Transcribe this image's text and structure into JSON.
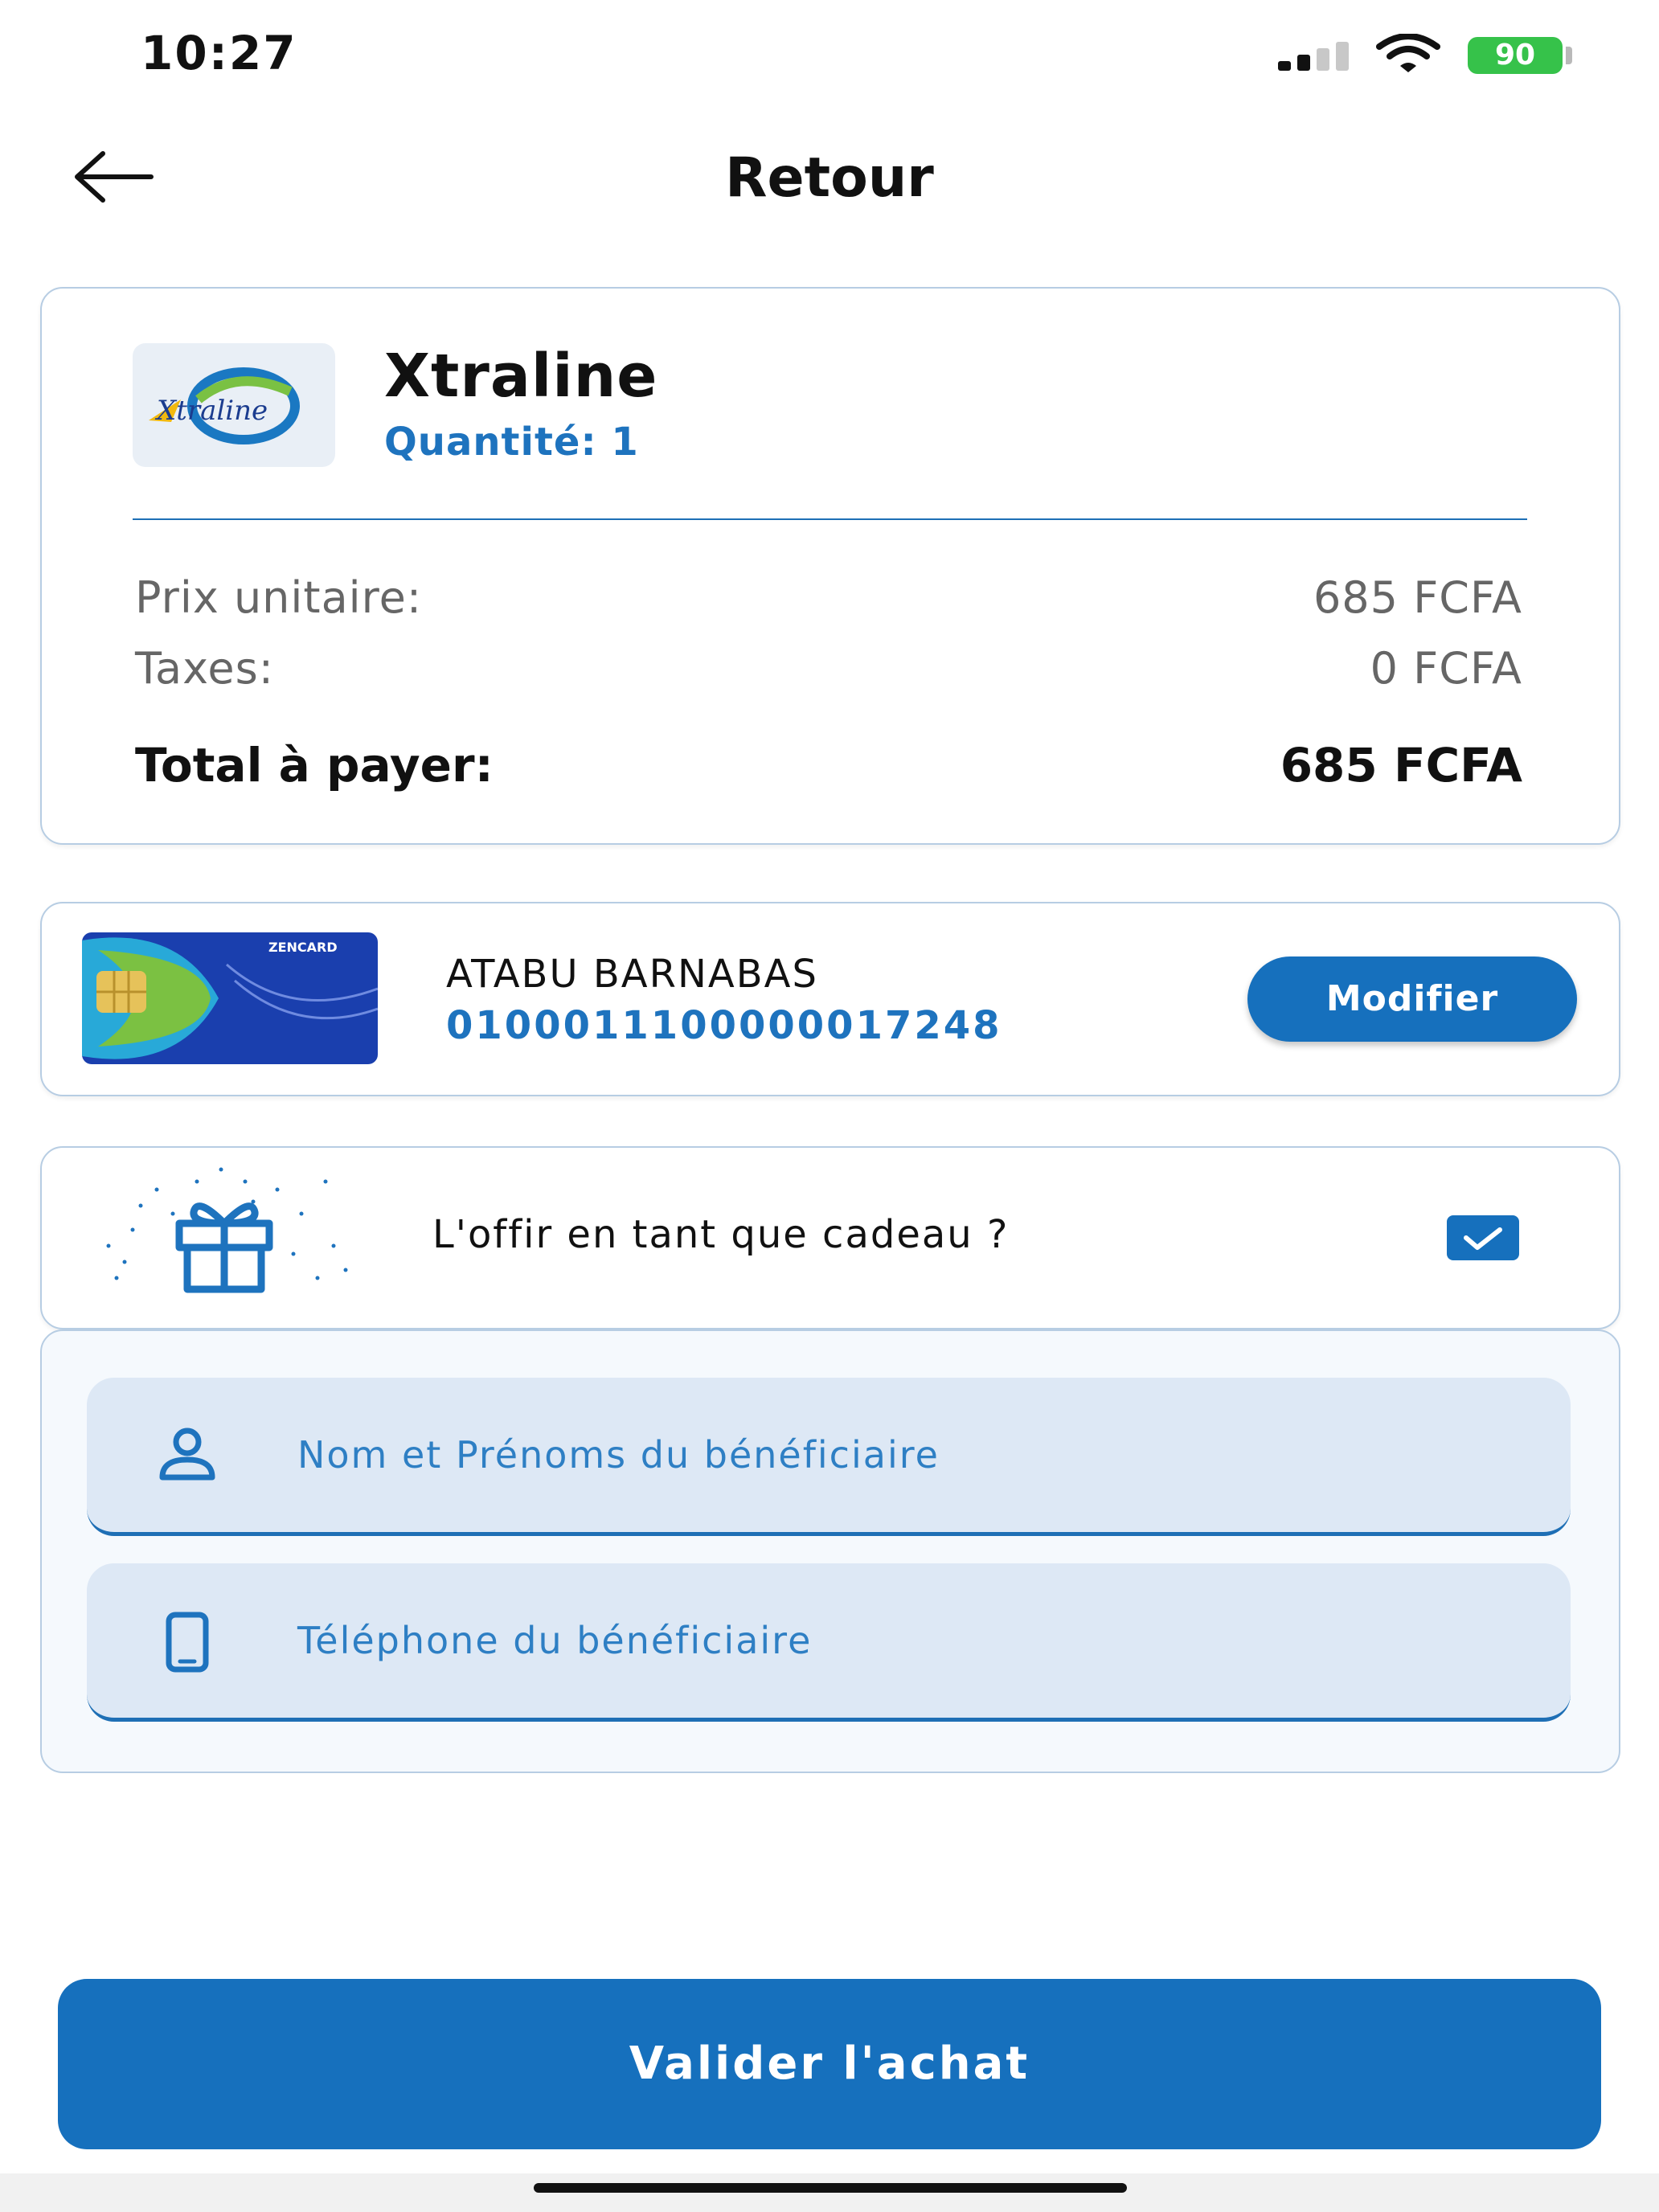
{
  "status_bar": {
    "time": "10:27",
    "battery": "90",
    "battery_color": "#36c24a"
  },
  "header": {
    "title": "Retour",
    "back_icon": "arrow-left-icon"
  },
  "product": {
    "logo_text": "Xtraline",
    "name": "Xtraline",
    "quantity_label": "Quantité:",
    "quantity_value": "1",
    "unit_price_label": "Prix unitaire:",
    "unit_price_value": "685 FCFA",
    "taxes_label": "Taxes:",
    "taxes_value": "0 FCFA",
    "total_label": "Total à payer:",
    "total_value": "685 FCFA"
  },
  "card": {
    "brand": "ZENCARD",
    "holder": "ATABU BARNABAS",
    "number": "0100011100000017248",
    "modify_label": "Modifier"
  },
  "gift": {
    "question": "L'offir en tant que cadeau ?",
    "checked": true
  },
  "beneficiary": {
    "name_placeholder": "Nom et Prénoms du bénéficiaire",
    "phone_placeholder": "Téléphone du bénéficiaire"
  },
  "actions": {
    "validate_label": "Valider l'achat"
  },
  "colors": {
    "accent": "#1670bd",
    "link": "#1e73be",
    "field_bg": "#dde8f5"
  }
}
